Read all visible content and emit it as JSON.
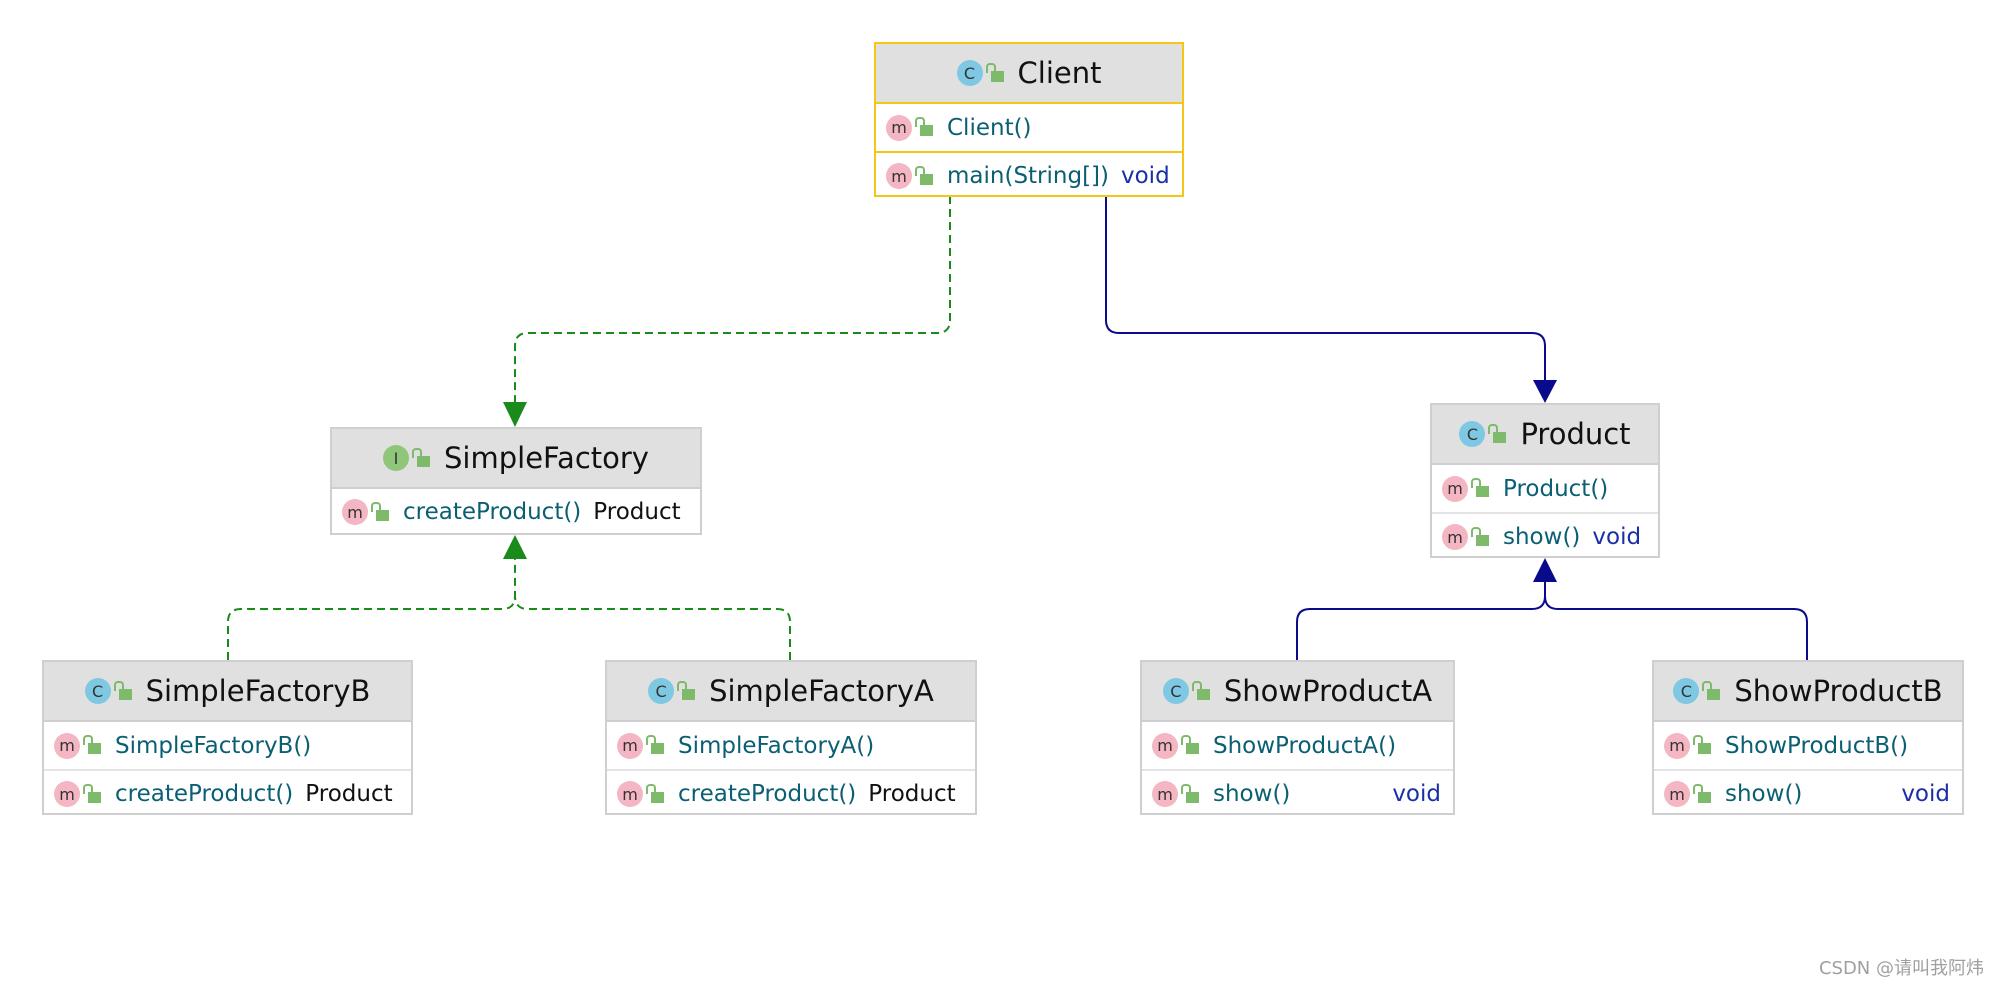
{
  "classes": {
    "client": {
      "title": "Client",
      "kind": "C",
      "rows": [
        {
          "name": "Client()",
          "type": ""
        },
        {
          "name": "main(String[])",
          "type": "void"
        }
      ]
    },
    "simple_factory": {
      "title": "SimpleFactory",
      "kind": "I",
      "rows": [
        {
          "name": "createProduct()",
          "type": "Product"
        }
      ]
    },
    "product": {
      "title": "Product",
      "kind": "C",
      "rows": [
        {
          "name": "Product()",
          "type": ""
        },
        {
          "name": "show()",
          "type": "void"
        }
      ]
    },
    "simple_factory_b": {
      "title": "SimpleFactoryB",
      "kind": "C",
      "rows": [
        {
          "name": "SimpleFactoryB()",
          "type": ""
        },
        {
          "name": "createProduct()",
          "type": "Product"
        }
      ]
    },
    "simple_factory_a": {
      "title": "SimpleFactoryA",
      "kind": "C",
      "rows": [
        {
          "name": "SimpleFactoryA()",
          "type": ""
        },
        {
          "name": "createProduct()",
          "type": "Product"
        }
      ]
    },
    "show_product_a": {
      "title": "ShowProductA",
      "kind": "C",
      "rows": [
        {
          "name": "ShowProductA()",
          "type": ""
        },
        {
          "name": "show()",
          "type": "void"
        }
      ]
    },
    "show_product_b": {
      "title": "ShowProductB",
      "kind": "C",
      "rows": [
        {
          "name": "ShowProductB()",
          "type": ""
        },
        {
          "name": "show()",
          "type": "void"
        }
      ]
    }
  },
  "method_icon": "m",
  "colors": {
    "dependency": "#1a8a1a",
    "association": "#0a0a8c",
    "selected_border": "#f5c518"
  },
  "watermark": "CSDN @请叫我阿炜"
}
